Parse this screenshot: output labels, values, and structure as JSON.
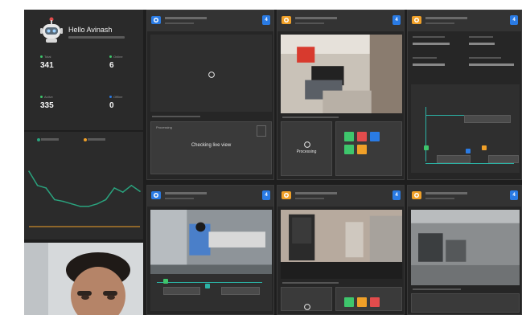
{
  "colors": {
    "accent_blue": "#2a7be4",
    "orange": "#f0a028",
    "green": "#3ec66c",
    "teal": "#2bb3a6",
    "red": "#e24c4c",
    "chart_line": "#2aa37e",
    "panel_bg": "#2c2c2c"
  },
  "profile": {
    "greeting": "Hello Avinash",
    "avatar_icon": "robot-avatar-icon"
  },
  "stats": [
    {
      "label": "Total",
      "value": "341",
      "dot": "#3ec66c"
    },
    {
      "label": "Online",
      "value": "6",
      "dot": "#3ec66c"
    },
    {
      "label": "Active",
      "value": "335",
      "dot": "#3ec66c"
    },
    {
      "label": "Offline",
      "value": "0",
      "dot": "#2a7be4"
    }
  ],
  "status_chart": {
    "legend": [
      "",
      ""
    ],
    "series": [
      {
        "values": [
          0.72,
          0.55,
          0.52,
          0.38,
          0.36,
          0.33,
          0.3,
          0.3,
          0.33,
          0.38,
          0.52,
          0.47,
          0.55,
          0.48
        ]
      }
    ]
  },
  "cameras": [
    {
      "icon": "camera-blue-icon",
      "badge": "4",
      "status_title": "Checking live view",
      "status_heading": "Processing",
      "spinner_icon": "loading-spinner-icon"
    },
    {
      "icon": "camera-orange-icon",
      "badge": "4",
      "processing_heading": "",
      "processing_text": "Processing",
      "spinner_icon": "loading-spinner-icon",
      "indicators": [
        "#3ec66c",
        "#e24c4c",
        "#2a7be4",
        "#3ec66c",
        "#f0a028"
      ]
    },
    {
      "icon": "camera-orange-icon",
      "badge": "4",
      "flow_nodes": [
        "",
        "",
        ""
      ],
      "flow_colors": [
        "#3ec66c",
        "#2a7be4",
        "#f0a028"
      ]
    },
    {
      "icon": "camera-blue-icon",
      "badge": "4",
      "flow_nodes": [
        "",
        ""
      ]
    },
    {
      "icon": "camera-orange-icon",
      "badge": "4",
      "processing_text": "",
      "spinner_icon": "loading-spinner-icon",
      "indicators": [
        "#3ec66c",
        "#f0a028",
        "#e24c4c"
      ]
    },
    {
      "icon": "camera-orange-icon",
      "badge": "4"
    }
  ],
  "webcam": {
    "icon": "user-video-icon"
  }
}
